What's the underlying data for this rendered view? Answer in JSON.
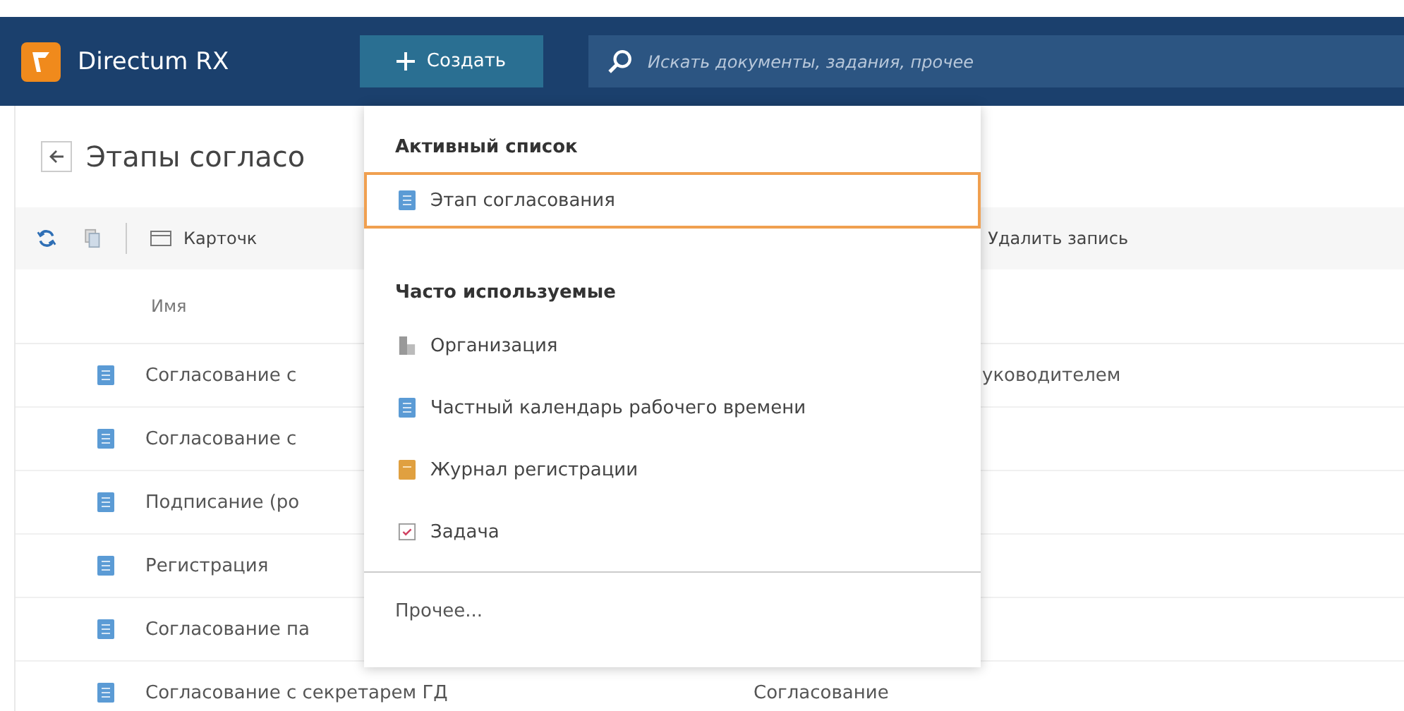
{
  "header": {
    "app_name": "Directum RX",
    "create_button": "Создать",
    "search": {
      "placeholder": "Искать документы, задания, прочее"
    }
  },
  "page": {
    "title": "Этапы согласо"
  },
  "toolbar": {
    "card_button": "Карточк",
    "delete_button": "Удалить запись"
  },
  "table": {
    "columns": [
      "Имя"
    ],
    "rows": [
      {
        "name": "Согласование с",
        "column_3": "уководителем"
      },
      {
        "name": "Согласование с"
      },
      {
        "name": "Подписание (ро"
      },
      {
        "name": "Регистрация"
      },
      {
        "name": "Согласование па"
      },
      {
        "name": "Согласование с секретарем ГД",
        "column_2": "Согласование"
      }
    ]
  },
  "create_menu": {
    "sections": [
      {
        "title": "Активный список",
        "items": [
          {
            "label": "Этап согласования",
            "kind": "stage",
            "selected": true
          }
        ]
      },
      {
        "title": "Часто используемые",
        "items": [
          {
            "label": "Организация",
            "kind": "org",
            "selected": false
          },
          {
            "label": "Частный календарь рабочего времени",
            "kind": "stage",
            "selected": false
          },
          {
            "label": "Журнал регистрации",
            "kind": "journal",
            "selected": false
          },
          {
            "label": "Задача",
            "kind": "task",
            "selected": false
          }
        ]
      }
    ],
    "more": "Прочее..."
  }
}
